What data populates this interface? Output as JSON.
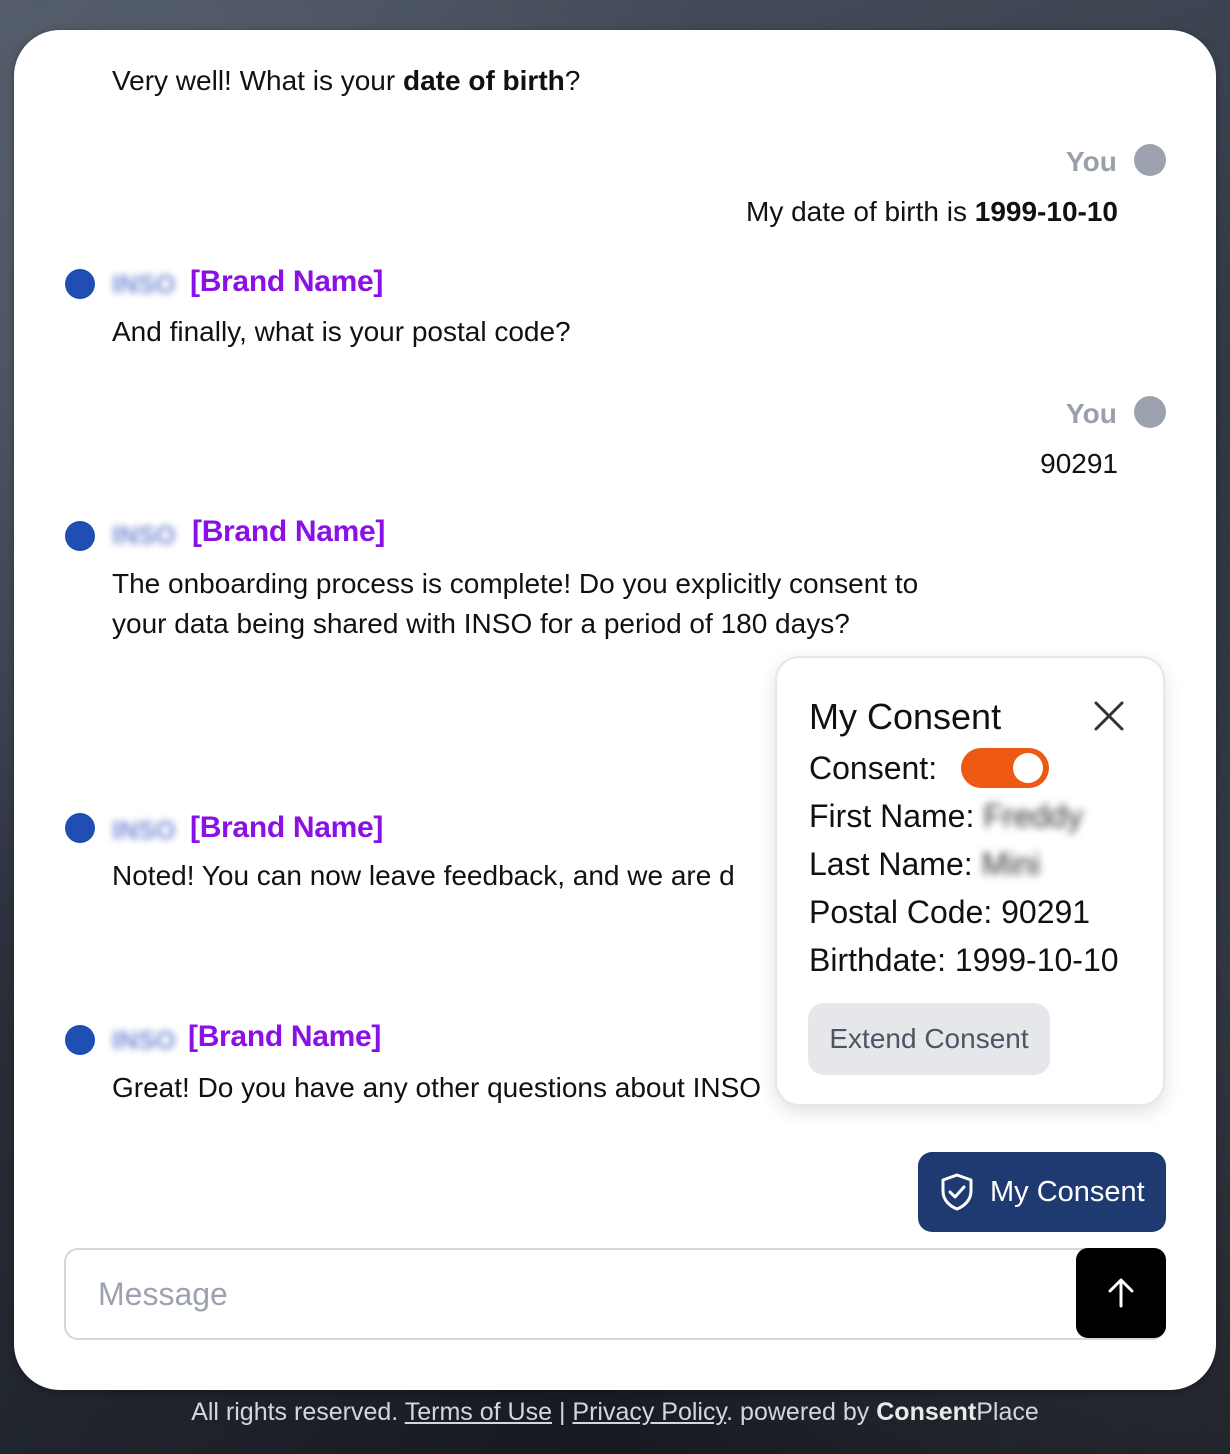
{
  "chat": {
    "partial_message_prefix": "Very well! What is your ",
    "partial_message_bold": "date of birth",
    "partial_message_suffix": "?",
    "user_label": "You",
    "bot_blurred_name": "INSO",
    "bot_brand": "[Brand Name]",
    "messages": [
      {
        "sender": "user",
        "text_prefix": "My date of birth is ",
        "text_bold": "1999-10-10"
      },
      {
        "sender": "bot",
        "text": "And finally, what is your postal code?"
      },
      {
        "sender": "user",
        "text": "90291"
      },
      {
        "sender": "bot",
        "line1": "The onboarding process is complete! Do you explicitly consent to",
        "line2": "your data being shared with INSO for a period of 180 days?"
      },
      {
        "sender": "bot",
        "text": "Noted! You can now leave feedback, and we are d"
      },
      {
        "sender": "bot",
        "text": "Great! Do you have any other questions about INSO"
      }
    ]
  },
  "consent_panel": {
    "title": "My Consent",
    "consent_label": "Consent:",
    "consent_on": true,
    "first_name_label": "First Name:",
    "first_name_value": "Freddy",
    "last_name_label": "Last Name:",
    "last_name_value": "Mini",
    "postal_code_label": "Postal Code:",
    "postal_code_value": "90291",
    "birthdate_label": "Birthdate:",
    "birthdate_value": "1999-10-10",
    "extend_button": "Extend Consent"
  },
  "my_consent_button": "My Consent",
  "composer": {
    "placeholder": "Message",
    "send_icon": "arrow-up-icon"
  },
  "footer": {
    "rights": "All rights reserved.",
    "terms": "Terms of Use",
    "separator": "|",
    "privacy": "Privacy Policy",
    "period": ".",
    "powered_by": "powered by",
    "brand_bold": "Consent",
    "brand_rest": "Place"
  },
  "colors": {
    "brand_purple": "#8b10e6",
    "bot_dot": "#1f4fb3",
    "user_dot": "#9ca3af",
    "toggle_on": "#ee5a14",
    "consent_button": "#1e3a70"
  }
}
